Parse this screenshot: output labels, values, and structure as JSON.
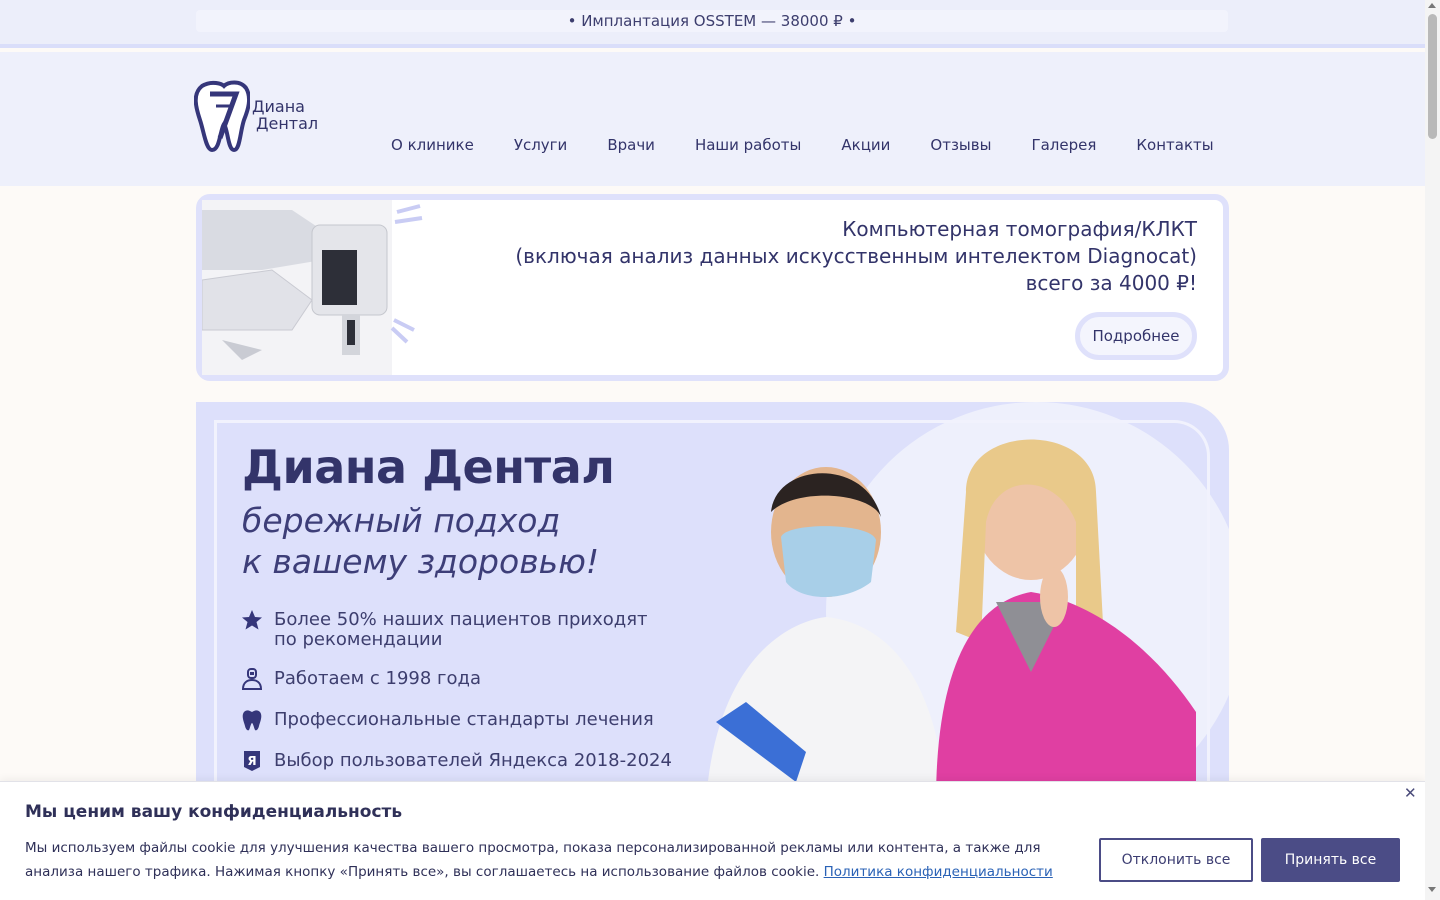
{
  "ticker": {
    "text": "• Имплантация OSSTEM — 38000 ₽ •"
  },
  "logo": {
    "line1": "Диана",
    "line2": "Дентал"
  },
  "nav": {
    "items": [
      "О клинике",
      "Услуги",
      "Врачи",
      "Наши работы",
      "Акции",
      "Отзывы",
      "Галерея",
      "Контакты"
    ]
  },
  "promo": {
    "line1": "Компьютерная томография/КЛКТ",
    "line2": "(включая анализ данных искусственным интелектом Diagnocat)",
    "line3": "всего за 4000 ₽!",
    "button": "Подробнее"
  },
  "hero": {
    "title": "Диана Дентал",
    "subtitle_line1": "бережный подход",
    "subtitle_line2": "к вашему здоровью!",
    "features": [
      {
        "icon": "star-icon",
        "text": "Более 50% наших пациентов приходят по рекомендации"
      },
      {
        "icon": "doctor-icon",
        "text": "Работаем с 1998 года"
      },
      {
        "icon": "tooth-icon",
        "text": "Профессиональные стандарты лечения"
      },
      {
        "icon": "yandex-icon",
        "text": "Выбор пользователей Яндекса 2018-2024"
      }
    ]
  },
  "cookie": {
    "title": "Мы ценим вашу конфиденциальность",
    "text": "Мы используем файлы cookie для улучшения качества вашего просмотра, показа персонализированной рекламы или контента, а также для анализа нашего трафика. Нажимая кнопку «Принять все», вы соглашаетесь на использование файлов cookie.",
    "link": "Политика конфиденциальности",
    "decline": "Отклонить все",
    "accept": "Принять все",
    "close": "✕"
  },
  "colors": {
    "brand": "#33346a",
    "accent": "#4b4c86",
    "hero_bg": "#dde0fb",
    "header_bg": "#eef0fb"
  }
}
